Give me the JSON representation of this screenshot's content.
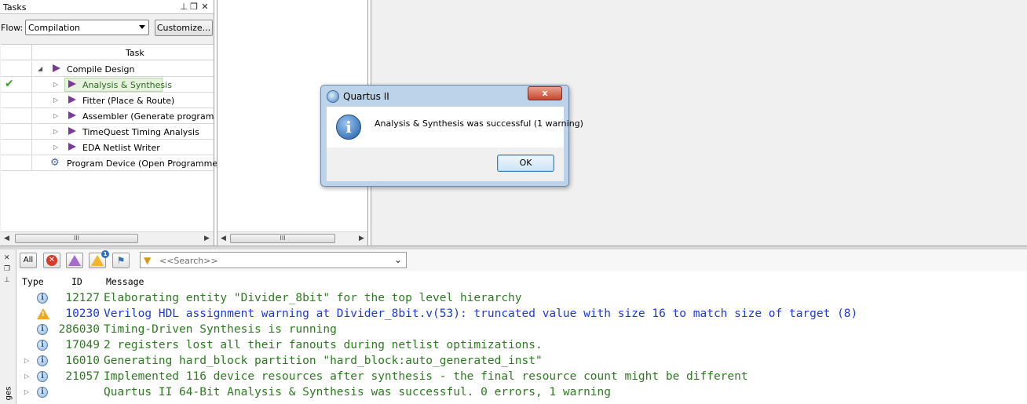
{
  "tasks_panel": {
    "title": "Tasks",
    "flow_label": "Flow:",
    "flow_value": "Compilation",
    "customize_label": "Customize...",
    "column_task": "Task",
    "scroll_thumb": "III",
    "rows": [
      {
        "label": "Compile Design"
      },
      {
        "label": "Analysis & Synthesis",
        "status": "complete"
      },
      {
        "label": "Fitter (Place & Route)"
      },
      {
        "label": "Assembler (Generate programming"
      },
      {
        "label": "TimeQuest Timing Analysis"
      },
      {
        "label": "EDA Netlist Writer"
      },
      {
        "label": "Program Device (Open Programmer)"
      }
    ]
  },
  "middle_panel": {
    "scroll_thumb": "III"
  },
  "dialog": {
    "title": "Quartus II",
    "close_glyph": "x",
    "icon": "information-icon",
    "message": "Analysis & Synthesis was successful (1 warning)",
    "ok_label": "OK"
  },
  "messages": {
    "toolbar": {
      "all_label": "All",
      "warning_badge": "1",
      "search_placeholder": "<<Search>>"
    },
    "columns": {
      "type": "Type",
      "id": "ID",
      "message": "Message"
    },
    "sidebar_label": "ges",
    "colors": {
      "info": "#2e7a22",
      "warning": "#1c3ccf"
    },
    "rows": [
      {
        "type": "info",
        "id": "12127",
        "text": "Elaborating entity \"Divider_8bit\" for the top level hierarchy"
      },
      {
        "type": "warning",
        "id": "10230",
        "text": "Verilog HDL assignment warning at Divider_8bit.v(53): truncated value with size 16 to match size of target (8)"
      },
      {
        "type": "info",
        "id": "286030",
        "text": "Timing-Driven Synthesis is running"
      },
      {
        "type": "info",
        "id": "17049",
        "text": "2 registers lost all their fanouts during netlist optimizations."
      },
      {
        "type": "info",
        "id": "16010",
        "text": "Generating hard_block partition \"hard_block:auto_generated_inst\""
      },
      {
        "type": "info",
        "id": "21057",
        "text": "Implemented 116 device resources after synthesis - the final resource count might be different"
      },
      {
        "type": "info",
        "id": "",
        "text": "Quartus II 64-Bit Analysis & Synthesis was successful. 0 errors, 1 warning"
      }
    ]
  }
}
